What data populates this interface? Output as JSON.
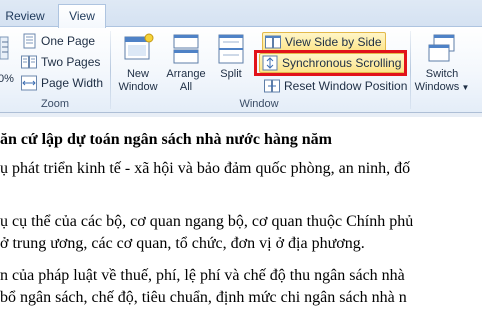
{
  "tabs": [
    {
      "label": "Review",
      "active": false
    },
    {
      "label": "View",
      "active": true
    }
  ],
  "ribbon": {
    "zoom_group": {
      "label": "Zoom",
      "partial_percent": "0%",
      "one_page": "One Page",
      "two_pages": "Two Pages",
      "page_width": "Page Width"
    },
    "window_group": {
      "label": "Window",
      "new_window": [
        "New",
        "Window"
      ],
      "arrange_all": [
        "Arrange",
        "All"
      ],
      "split": "Split",
      "view_side_by_side": "View Side by Side",
      "synchronous_scrolling": "Synchronous Scrolling",
      "reset_window_position": "Reset Window Position"
    },
    "switch_windows": [
      "Switch",
      "Windows"
    ],
    "accent_highlight": "#fde58a",
    "annotation_color": "#e2121a"
  },
  "document": {
    "lines": [
      "ăn cứ lập dự toán ngân sách nhà nước hàng năm",
      "ụ phát triển kinh tế - xã hội và bảo đảm quốc phòng, an ninh, đố",
      "ụ cụ thể của các bộ, cơ quan ngang bộ, cơ quan thuộc Chính phủ",
      "ở trung ương, các cơ quan, tổ chức, đơn vị ở địa phương.",
      "n của pháp luật về thuế, phí, lệ phí và chế độ thu ngân sách nhà",
      "bổ ngân sách, chế độ, tiêu chuẩn, định mức chi ngân sách nhà n"
    ]
  }
}
